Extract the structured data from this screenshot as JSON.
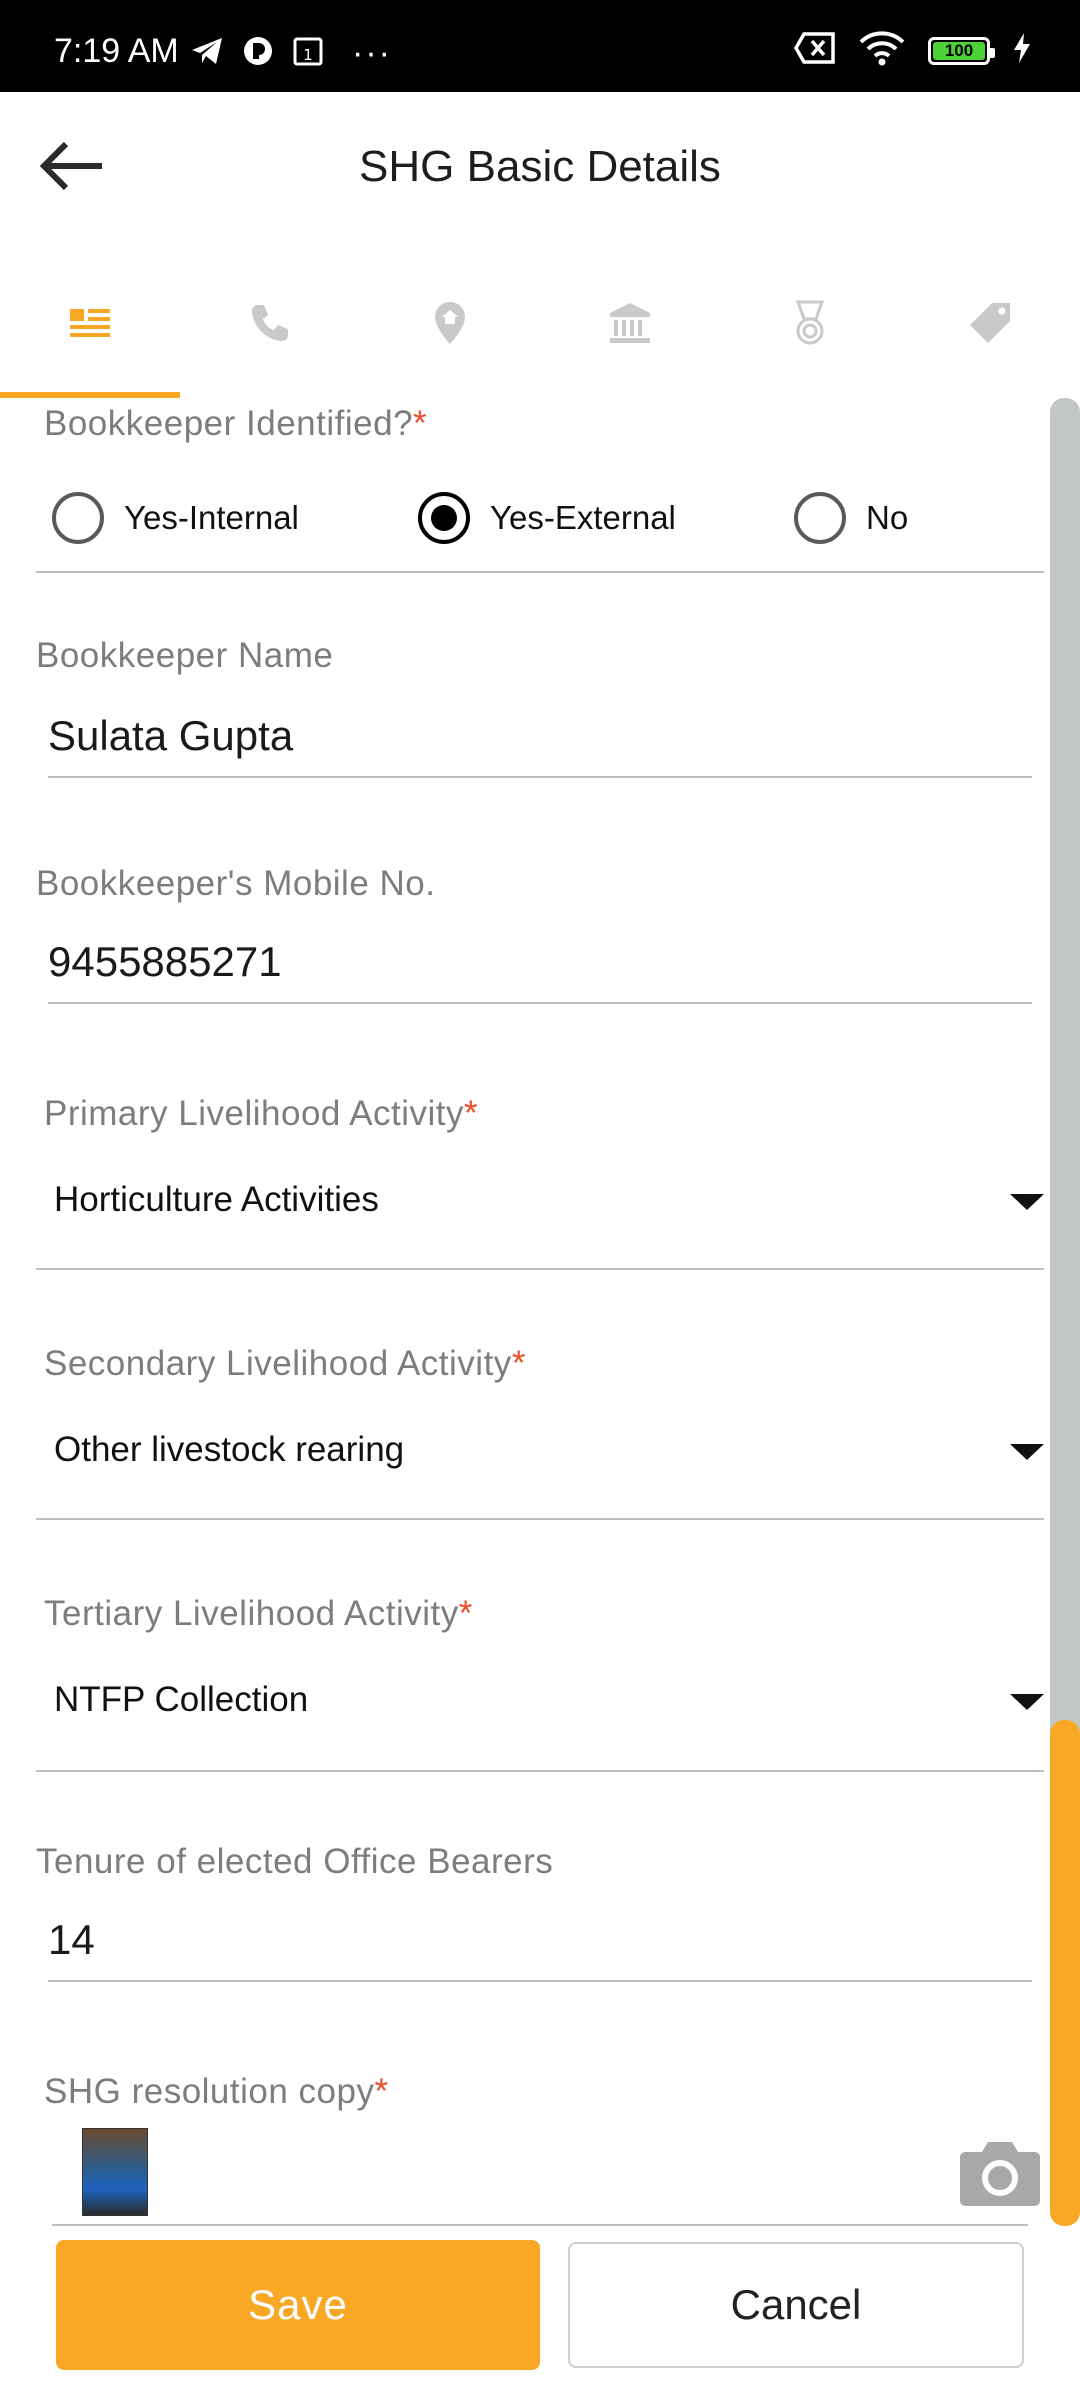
{
  "status_bar": {
    "time": "7:19 AM",
    "icons": [
      "telegram-icon",
      "app-icon",
      "calendar-icon",
      "more-dots-icon",
      "sim-off-icon",
      "wifi-icon",
      "battery-icon",
      "charging-icon"
    ],
    "battery_level": "100",
    "more": "···"
  },
  "header": {
    "title": "SHG Basic Details"
  },
  "tabs": [
    {
      "icon": "details-list-icon",
      "active": true
    },
    {
      "icon": "phone-icon",
      "active": false
    },
    {
      "icon": "location-pin-icon",
      "active": false
    },
    {
      "icon": "bank-icon",
      "active": false
    },
    {
      "icon": "medal-icon",
      "active": false
    },
    {
      "icon": "tag-icon",
      "active": false
    }
  ],
  "form": {
    "bookkeeper_identified": {
      "label": "Bookkeeper Identified?",
      "required_mark": "*",
      "options": [
        "Yes-Internal",
        "Yes-External",
        "No"
      ],
      "selected": "Yes-External"
    },
    "bookkeeper_name": {
      "label": "Bookkeeper Name",
      "value": "Sulata Gupta"
    },
    "bookkeeper_mobile": {
      "label": "Bookkeeper's Mobile No.",
      "value": "9455885271"
    },
    "primary_livelihood": {
      "label": "Primary Livelihood Activity",
      "required_mark": "*",
      "value": "Horticulture Activities"
    },
    "secondary_livelihood": {
      "label": "Secondary Livelihood Activity",
      "required_mark": "*",
      "value": "Other livestock rearing"
    },
    "tertiary_livelihood": {
      "label": "Tertiary Livelihood Activity",
      "required_mark": "*",
      "value": "NTFP Collection"
    },
    "tenure": {
      "label": "Tenure of elected Office Bearers",
      "value": "14"
    },
    "resolution_copy": {
      "label": "SHG resolution copy",
      "required_mark": "*"
    }
  },
  "buttons": {
    "save": "Save",
    "cancel": "Cancel"
  },
  "colors": {
    "accent": "#f9a825",
    "required": "#ef4c2a",
    "label": "#7d7d7d"
  }
}
